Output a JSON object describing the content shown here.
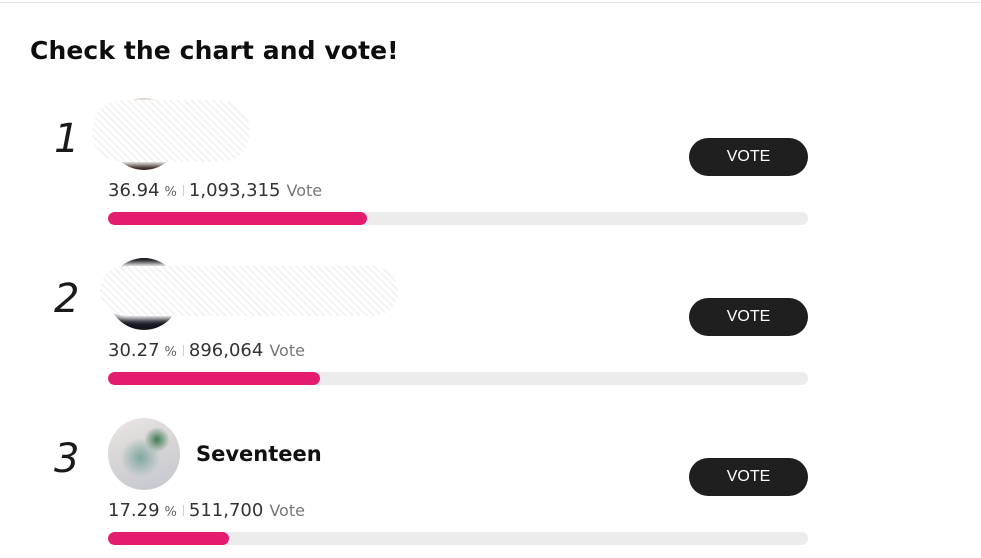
{
  "page": {
    "title": "Check the chart and vote!"
  },
  "entries": [
    {
      "rank": "1",
      "name": "",
      "percent": "36.94",
      "percent_sign": "%",
      "votes": "1,093,315",
      "vote_word": "Vote",
      "share": 0.3694,
      "button_label": "VOTE"
    },
    {
      "rank": "2",
      "name": "",
      "percent": "30.27",
      "percent_sign": "%",
      "votes": "896,064",
      "vote_word": "Vote",
      "share": 0.3027,
      "button_label": "VOTE"
    },
    {
      "rank": "3",
      "name": "Seventeen",
      "percent": "17.29",
      "percent_sign": "%",
      "votes": "511,700",
      "vote_word": "Vote",
      "share": 0.1729,
      "button_label": "VOTE"
    }
  ],
  "colors": {
    "accent": "#e31c6f",
    "button": "#1f1f1f",
    "track": "#ececec"
  }
}
